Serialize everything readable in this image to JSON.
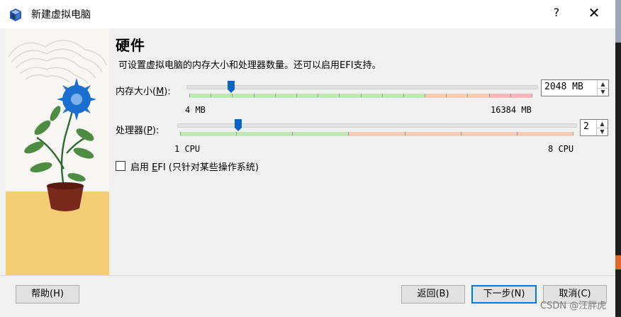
{
  "window": {
    "title": "新建虚拟电脑",
    "help_glyph": "?",
    "close_glyph": "✕"
  },
  "page": {
    "heading": "硬件",
    "description": "可设置虚拟电脑的内存大小和处理器数量。还可以启用EFI支持。"
  },
  "memory": {
    "label_prefix": "内存大小(",
    "label_key": "M",
    "label_suffix": "):",
    "min_label": "4 MB",
    "max_label": "16384 MB",
    "value_text": "2048 MB",
    "value": 2048,
    "min": 4,
    "max": 16384
  },
  "processor": {
    "label_prefix": "处理器(",
    "label_key": "P",
    "label_suffix": "):",
    "min_label": "1 CPU",
    "max_label": "8 CPU",
    "value_text": "2",
    "value": 2,
    "min": 1,
    "max": 8
  },
  "efi": {
    "label_prefix": "启用 ",
    "label_key": "E",
    "label_rest": "FI (只针对某些操作系统)",
    "checked": false
  },
  "buttons": {
    "help": "帮助(H)",
    "back": "返回(B)",
    "next": "下一步(N)",
    "cancel": "取消(C)"
  },
  "watermark": "CSDN @汪胖虎",
  "colors": {
    "accent": "#0078d7",
    "slider_green": "#bfe8b4",
    "slider_orange": "#f5cdb7",
    "slider_red": "#f4b8b8",
    "thumb_blue": "#0a64c8"
  },
  "icons": {
    "app": "virtualbox-icon",
    "spin_up": "spin-up-icon",
    "spin_down": "spin-down-icon"
  }
}
